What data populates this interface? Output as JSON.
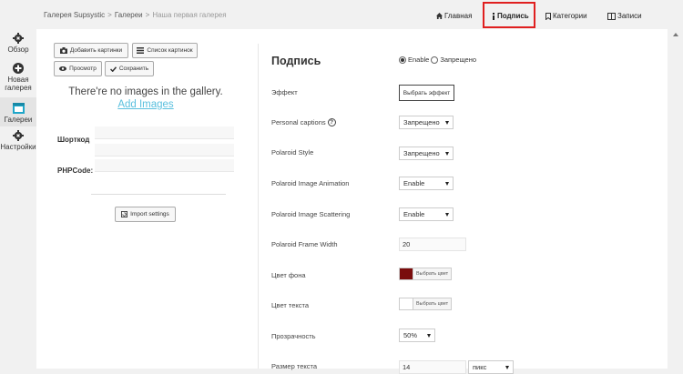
{
  "sidebar": {
    "items": [
      {
        "label": "Обзор",
        "icon": "gear-icon"
      },
      {
        "label": "Новая галерея",
        "icon": "plus-circle-icon"
      },
      {
        "label": "Галереи",
        "icon": "gallery-icon"
      },
      {
        "label": "Настройки",
        "icon": "gear-icon"
      }
    ]
  },
  "breadcrumb": {
    "items": [
      "Галерея Supsystic",
      "Галереи",
      "Наша первая галерея"
    ],
    "separator": ">"
  },
  "tabs": [
    {
      "label": "Главная",
      "icon": "home-icon"
    },
    {
      "label": "Подпись",
      "icon": "info-icon",
      "active": true
    },
    {
      "label": "Категории",
      "icon": "bookmark-icon"
    },
    {
      "label": "Записи",
      "icon": "columns-icon"
    }
  ],
  "gallery": {
    "buttons": {
      "add_images": "Добавить картинки",
      "image_list": "Список картинок",
      "preview": "Просмотр",
      "save": "Сохранить",
      "import_settings": "Import settings"
    },
    "empty_message": "There're no images in the gallery.",
    "add_images_link": "Add Images",
    "shortcode_label": "Шорткод",
    "phpcode_label": "PHPCode:"
  },
  "caption": {
    "title": "Подпись",
    "enable_label": "Enable",
    "disable_label": "Запрещено",
    "enabled": true,
    "rows": {
      "effect": {
        "label": "Эффект",
        "button": "Выбрать эффект"
      },
      "personal_captions": {
        "label": "Personal captions",
        "value": "Запрещено"
      },
      "polaroid_style": {
        "label": "Polaroid Style",
        "value": "Запрещено"
      },
      "polaroid_animation": {
        "label": "Polaroid Image Animation",
        "value": "Enable"
      },
      "polaroid_scattering": {
        "label": "Polaroid Image Scattering",
        "value": "Enable"
      },
      "polaroid_frame_width": {
        "label": "Polaroid Frame Width",
        "value": "20"
      },
      "background_color": {
        "label": "Цвет фона",
        "button": "Выбрать цвет",
        "color": "#7a0c0c"
      },
      "text_color": {
        "label": "Цвет текста",
        "button": "Выбрать цвет",
        "color": "#ffffff"
      },
      "opacity": {
        "label": "Прозрачность",
        "value": "50%"
      },
      "text_size": {
        "label": "Размер текста",
        "value": "14",
        "unit": "пикс"
      }
    }
  },
  "colors": {
    "highlight": "#e02020",
    "link": "#5bc0de",
    "active_sidebar": "#1fa6c9"
  }
}
